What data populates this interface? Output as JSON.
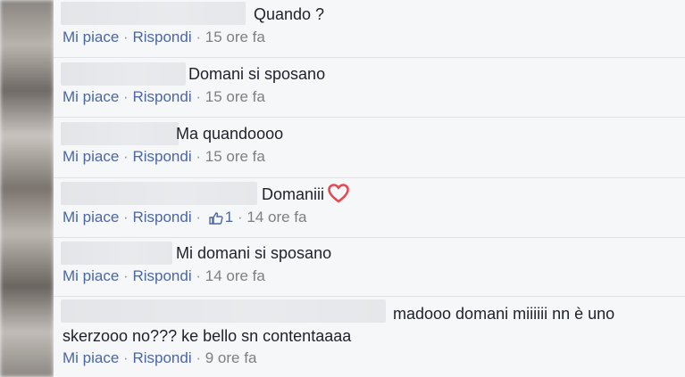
{
  "comments": [
    {
      "text": "Quando ?",
      "like": "Mi piace",
      "sep": "·",
      "reply": "Rispondi",
      "time": "15 ore fa"
    },
    {
      "text": "Domani si sposano",
      "like": "Mi piace",
      "sep": "·",
      "reply": "Rispondi",
      "time": "15 ore fa"
    },
    {
      "text": "Ma quandoooo",
      "like": "Mi piace",
      "sep": "·",
      "reply": "Rispondi",
      "time": "15 ore fa"
    },
    {
      "text": "Domaniii",
      "like": "Mi piace",
      "sep": "·",
      "reply": "Rispondi",
      "likes_count": "1",
      "time": "14 ore fa",
      "emoji": "heart-icon"
    },
    {
      "text": "Mi domani si sposano",
      "like": "Mi piace",
      "sep": "·",
      "reply": "Rispondi",
      "time": "14 ore fa"
    },
    {
      "text_line1": "madooo domani miiiiii nn è uno",
      "text_line2": "skerzooo no??? ke bello sn contentaaaa",
      "like": "Mi piace",
      "sep": "·",
      "reply": "Rispondi",
      "time": "9 ore fa"
    }
  ],
  "colors": {
    "link": "#4b67a1",
    "meta": "#7f7f7f",
    "heart": "#e8484f"
  }
}
